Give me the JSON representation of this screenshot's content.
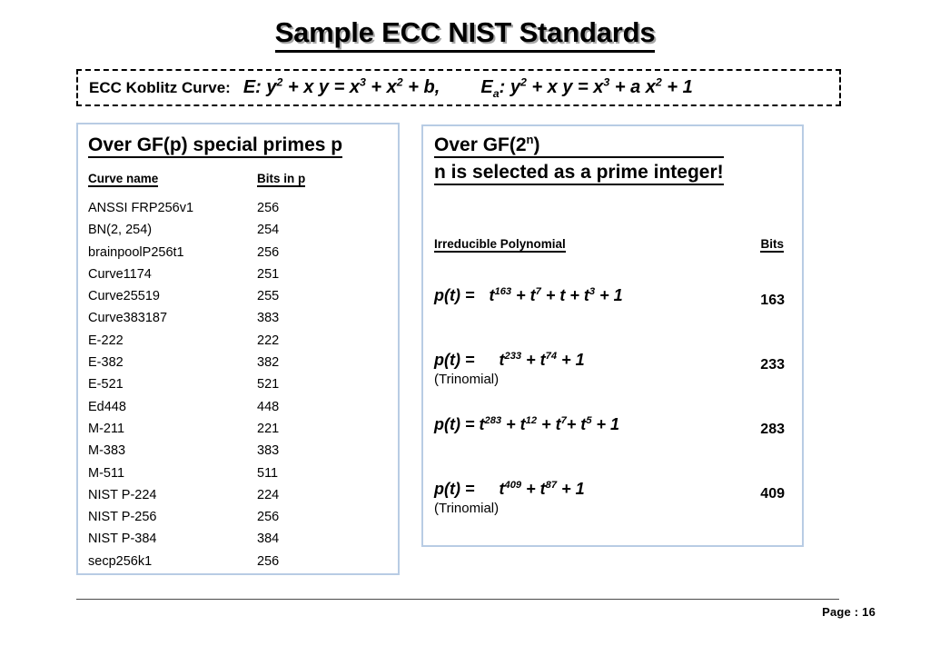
{
  "title": "Sample ECC NIST Standards",
  "curve_equation": {
    "label": "ECC Koblitz Curve:",
    "equation_1_html": "E: y<sup>2</sup> + x y = x<sup>3</sup> + x<sup>2</sup> + b,",
    "equation_2_html": "E<sub>a</sub>: y<sup>2</sup> + x y = x<sup>3</sup> + a x<sup>2</sup> + 1"
  },
  "gfp_panel": {
    "heading": "Over GF(p) special primes p",
    "columns": [
      "Curve name ",
      "Bits in p"
    ],
    "rows": [
      {
        "name": "ANSSI FRP256v1",
        "bits": "256"
      },
      {
        "name": "BN(2, 254)",
        "bits": "254"
      },
      {
        "name": "brainpoolP256t1",
        "bits": "256"
      },
      {
        "name": "Curve1174",
        "bits": "251"
      },
      {
        "name": "Curve25519",
        "bits": "255"
      },
      {
        "name": "Curve383187",
        "bits": "383"
      },
      {
        "name": "E-222",
        "bits": "222"
      },
      {
        "name": "E-382",
        "bits": "382"
      },
      {
        "name": "E-521",
        "bits": "521"
      },
      {
        "name": "Ed448",
        "bits": "448"
      },
      {
        "name": "M-211",
        "bits": "221"
      },
      {
        "name": "M-383",
        "bits": "383"
      },
      {
        "name": "M-511",
        "bits": "511"
      },
      {
        "name": "NIST P-224",
        "bits": "224"
      },
      {
        "name": "NIST P-256",
        "bits": "256"
      },
      {
        "name": "NIST P-384",
        "bits": "384"
      },
      {
        "name": "secp256k1",
        "bits": "256"
      }
    ]
  },
  "gf2n_panel": {
    "heading_line_1_html": "Over GF(2<sup>n</sup>)",
    "heading_line_2": "n is selected as a prime integer!",
    "columns": [
      "Irreducible Polynomial",
      "Bits"
    ],
    "rows": [
      {
        "polynomial_html": "p(t) = <span class=\"sp\"></span>t<sup>163</sup> + t<sup>7</sup> + t  + t<sup>3</sup> + 1",
        "note": "",
        "bits": "163"
      },
      {
        "polynomial_html": "p(t) = <span class=\"sp\"></span><span class=\"sp\"></span>t<sup>233</sup> + t<sup>74</sup> + 1",
        "note": "(Trinomial)",
        "bits": "233"
      },
      {
        "polynomial_html": "p(t) = t<sup>283</sup> + t<sup>12</sup> + t<sup>7</sup>+ t<sup>5</sup> + 1",
        "note": "",
        "bits": "283"
      },
      {
        "polynomial_html": "p(t) = <span class=\"sp\"></span><span class=\"sp\"></span>t<sup>409</sup> + t<sup>87</sup> + 1",
        "note": "(Trinomial)",
        "bits": "409"
      }
    ]
  },
  "footer": {
    "page_label": "Page :  16"
  },
  "colors": {
    "panel_border": "#b8cce4",
    "text": "#000000",
    "title_shadow": "#a6a6a6",
    "footer_rule": "#4a4a4a"
  }
}
